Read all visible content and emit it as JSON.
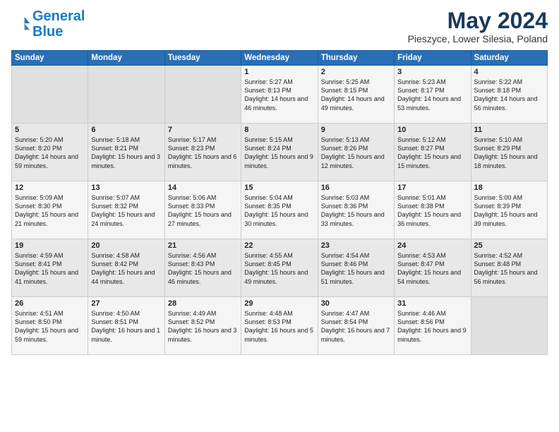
{
  "logo": {
    "line1": "General",
    "line2": "Blue"
  },
  "title": "May 2024",
  "subtitle": "Pieszyce, Lower Silesia, Poland",
  "weekdays": [
    "Sunday",
    "Monday",
    "Tuesday",
    "Wednesday",
    "Thursday",
    "Friday",
    "Saturday"
  ],
  "weeks": [
    [
      {
        "day": "",
        "sunrise": "",
        "sunset": "",
        "daylight": ""
      },
      {
        "day": "",
        "sunrise": "",
        "sunset": "",
        "daylight": ""
      },
      {
        "day": "",
        "sunrise": "",
        "sunset": "",
        "daylight": ""
      },
      {
        "day": "1",
        "sunrise": "Sunrise: 5:27 AM",
        "sunset": "Sunset: 8:13 PM",
        "daylight": "Daylight: 14 hours and 46 minutes."
      },
      {
        "day": "2",
        "sunrise": "Sunrise: 5:25 AM",
        "sunset": "Sunset: 8:15 PM",
        "daylight": "Daylight: 14 hours and 49 minutes."
      },
      {
        "day": "3",
        "sunrise": "Sunrise: 5:23 AM",
        "sunset": "Sunset: 8:17 PM",
        "daylight": "Daylight: 14 hours and 53 minutes."
      },
      {
        "day": "4",
        "sunrise": "Sunrise: 5:22 AM",
        "sunset": "Sunset: 8:18 PM",
        "daylight": "Daylight: 14 hours and 56 minutes."
      }
    ],
    [
      {
        "day": "5",
        "sunrise": "Sunrise: 5:20 AM",
        "sunset": "Sunset: 8:20 PM",
        "daylight": "Daylight: 14 hours and 59 minutes."
      },
      {
        "day": "6",
        "sunrise": "Sunrise: 5:18 AM",
        "sunset": "Sunset: 8:21 PM",
        "daylight": "Daylight: 15 hours and 3 minutes."
      },
      {
        "day": "7",
        "sunrise": "Sunrise: 5:17 AM",
        "sunset": "Sunset: 8:23 PM",
        "daylight": "Daylight: 15 hours and 6 minutes."
      },
      {
        "day": "8",
        "sunrise": "Sunrise: 5:15 AM",
        "sunset": "Sunset: 8:24 PM",
        "daylight": "Daylight: 15 hours and 9 minutes."
      },
      {
        "day": "9",
        "sunrise": "Sunrise: 5:13 AM",
        "sunset": "Sunset: 8:26 PM",
        "daylight": "Daylight: 15 hours and 12 minutes."
      },
      {
        "day": "10",
        "sunrise": "Sunrise: 5:12 AM",
        "sunset": "Sunset: 8:27 PM",
        "daylight": "Daylight: 15 hours and 15 minutes."
      },
      {
        "day": "11",
        "sunrise": "Sunrise: 5:10 AM",
        "sunset": "Sunset: 8:29 PM",
        "daylight": "Daylight: 15 hours and 18 minutes."
      }
    ],
    [
      {
        "day": "12",
        "sunrise": "Sunrise: 5:09 AM",
        "sunset": "Sunset: 8:30 PM",
        "daylight": "Daylight: 15 hours and 21 minutes."
      },
      {
        "day": "13",
        "sunrise": "Sunrise: 5:07 AM",
        "sunset": "Sunset: 8:32 PM",
        "daylight": "Daylight: 15 hours and 24 minutes."
      },
      {
        "day": "14",
        "sunrise": "Sunrise: 5:06 AM",
        "sunset": "Sunset: 8:33 PM",
        "daylight": "Daylight: 15 hours and 27 minutes."
      },
      {
        "day": "15",
        "sunrise": "Sunrise: 5:04 AM",
        "sunset": "Sunset: 8:35 PM",
        "daylight": "Daylight: 15 hours and 30 minutes."
      },
      {
        "day": "16",
        "sunrise": "Sunrise: 5:03 AM",
        "sunset": "Sunset: 8:36 PM",
        "daylight": "Daylight: 15 hours and 33 minutes."
      },
      {
        "day": "17",
        "sunrise": "Sunrise: 5:01 AM",
        "sunset": "Sunset: 8:38 PM",
        "daylight": "Daylight: 15 hours and 36 minutes."
      },
      {
        "day": "18",
        "sunrise": "Sunrise: 5:00 AM",
        "sunset": "Sunset: 8:39 PM",
        "daylight": "Daylight: 15 hours and 39 minutes."
      }
    ],
    [
      {
        "day": "19",
        "sunrise": "Sunrise: 4:59 AM",
        "sunset": "Sunset: 8:41 PM",
        "daylight": "Daylight: 15 hours and 41 minutes."
      },
      {
        "day": "20",
        "sunrise": "Sunrise: 4:58 AM",
        "sunset": "Sunset: 8:42 PM",
        "daylight": "Daylight: 15 hours and 44 minutes."
      },
      {
        "day": "21",
        "sunrise": "Sunrise: 4:56 AM",
        "sunset": "Sunset: 8:43 PM",
        "daylight": "Daylight: 15 hours and 46 minutes."
      },
      {
        "day": "22",
        "sunrise": "Sunrise: 4:55 AM",
        "sunset": "Sunset: 8:45 PM",
        "daylight": "Daylight: 15 hours and 49 minutes."
      },
      {
        "day": "23",
        "sunrise": "Sunrise: 4:54 AM",
        "sunset": "Sunset: 8:46 PM",
        "daylight": "Daylight: 15 hours and 51 minutes."
      },
      {
        "day": "24",
        "sunrise": "Sunrise: 4:53 AM",
        "sunset": "Sunset: 8:47 PM",
        "daylight": "Daylight: 15 hours and 54 minutes."
      },
      {
        "day": "25",
        "sunrise": "Sunrise: 4:52 AM",
        "sunset": "Sunset: 8:48 PM",
        "daylight": "Daylight: 15 hours and 56 minutes."
      }
    ],
    [
      {
        "day": "26",
        "sunrise": "Sunrise: 4:51 AM",
        "sunset": "Sunset: 8:50 PM",
        "daylight": "Daylight: 15 hours and 59 minutes."
      },
      {
        "day": "27",
        "sunrise": "Sunrise: 4:50 AM",
        "sunset": "Sunset: 8:51 PM",
        "daylight": "Daylight: 16 hours and 1 minute."
      },
      {
        "day": "28",
        "sunrise": "Sunrise: 4:49 AM",
        "sunset": "Sunset: 8:52 PM",
        "daylight": "Daylight: 16 hours and 3 minutes."
      },
      {
        "day": "29",
        "sunrise": "Sunrise: 4:48 AM",
        "sunset": "Sunset: 8:53 PM",
        "daylight": "Daylight: 16 hours and 5 minutes."
      },
      {
        "day": "30",
        "sunrise": "Sunrise: 4:47 AM",
        "sunset": "Sunset: 8:54 PM",
        "daylight": "Daylight: 16 hours and 7 minutes."
      },
      {
        "day": "31",
        "sunrise": "Sunrise: 4:46 AM",
        "sunset": "Sunset: 8:56 PM",
        "daylight": "Daylight: 16 hours and 9 minutes."
      },
      {
        "day": "",
        "sunrise": "",
        "sunset": "",
        "daylight": ""
      }
    ]
  ]
}
